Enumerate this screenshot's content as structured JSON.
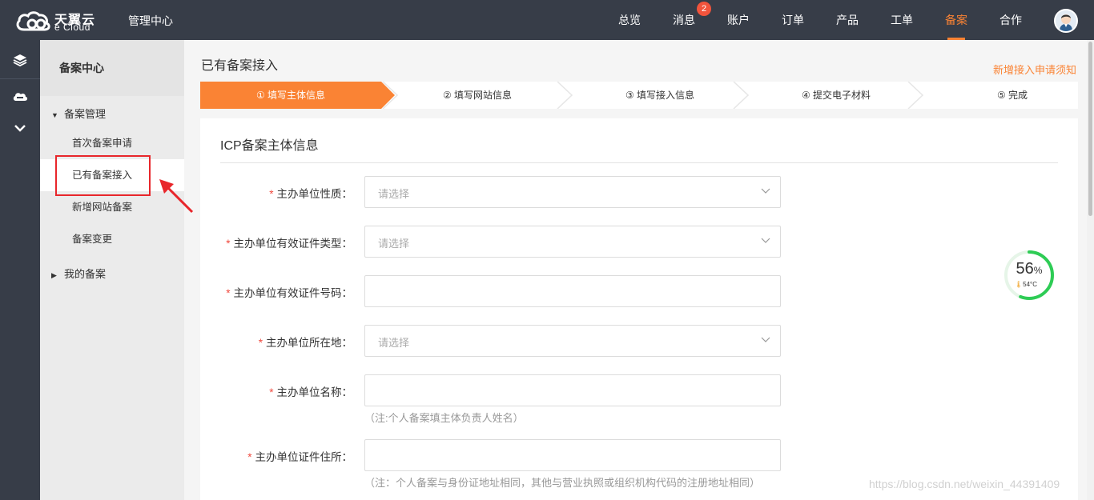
{
  "header": {
    "brand_cn": "天翼云",
    "brand_en": "e Cloud",
    "title": "管理中心",
    "nav": [
      {
        "label": "总览"
      },
      {
        "label": "消息",
        "badge": "2"
      },
      {
        "label": "账户"
      },
      {
        "label": "订单"
      },
      {
        "label": "产品"
      },
      {
        "label": "工单"
      },
      {
        "label": "备案",
        "active": true
      },
      {
        "label": "合作"
      }
    ],
    "accent_color": "#fa8334"
  },
  "rail": {
    "icons": [
      "layers-icon",
      "cloud-icon",
      "chevron-down-icon"
    ]
  },
  "sidebar": {
    "title": "备案中心",
    "groups": [
      {
        "label": "备案管理",
        "expanded": true,
        "items": [
          {
            "label": "首次备案申请"
          },
          {
            "label": "已有备案接入",
            "active": true
          },
          {
            "label": "新增网站备案"
          },
          {
            "label": "备案变更"
          }
        ]
      },
      {
        "label": "我的备案",
        "expanded": false
      }
    ]
  },
  "main": {
    "page_title": "已有备案接入",
    "notice_link": "新增接入申请须知",
    "steps": [
      {
        "label": "① 填写主体信息",
        "active": true
      },
      {
        "label": "② 填写网站信息"
      },
      {
        "label": "③ 填写接入信息"
      },
      {
        "label": "④ 提交电子材料"
      },
      {
        "label": "⑤ 完成"
      }
    ],
    "card_title": "ICP备案主体信息",
    "form": [
      {
        "label": "主办单位性质：",
        "required": "*",
        "type": "select",
        "placeholder": "请选择"
      },
      {
        "label": "主办单位有效证件类型：",
        "required": "*",
        "type": "select",
        "placeholder": "请选择"
      },
      {
        "label": "主办单位有效证件号码：",
        "required": "*",
        "type": "input",
        "placeholder": ""
      },
      {
        "label": "主办单位所在地：",
        "required": "*",
        "type": "select",
        "placeholder": "请选择"
      },
      {
        "label": "主办单位名称：",
        "required": "*",
        "type": "input",
        "placeholder": "",
        "hint": "（注:个人备案填主体负责人姓名）"
      },
      {
        "label": "主办单位证件住所：",
        "required": "*",
        "type": "input",
        "placeholder": "",
        "hint": "（注：个人备案与身份证地址相同，其他与营业执照或组织机构代码的注册地址相同）"
      }
    ]
  },
  "widget": {
    "percent": "56",
    "percent_unit": "%",
    "percent_value": 0.56,
    "temperature": "54°C"
  },
  "watermark": "https://blog.csdn.net/weixin_44391409"
}
